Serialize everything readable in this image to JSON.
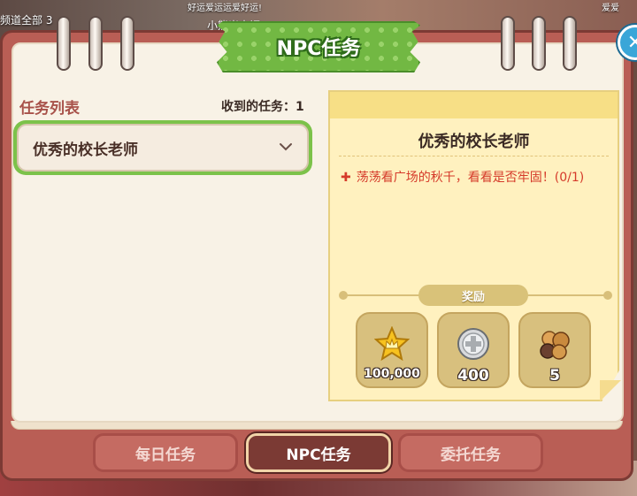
{
  "background": {
    "top_texts": [
      "频道全部 3",
      "小熊米大福",
      "好运爱运运爱好运!",
      "爱爱"
    ]
  },
  "dialog": {
    "title": "NPC任务",
    "close_icon": "close-icon"
  },
  "quest_list": {
    "heading": "任务列表",
    "received_label": "收到的任务：1",
    "items": [
      {
        "label": "优秀的校长老师",
        "selected": true
      }
    ]
  },
  "quest_detail": {
    "title": "优秀的校长老师",
    "objective": "荡荡看广场的秋千，看看是否牢固！(0/1)",
    "reward_label": "奖励",
    "rewards": [
      {
        "icon": "star-crown-icon",
        "value": "100,000"
      },
      {
        "icon": "silver-coin-icon",
        "value": "400"
      },
      {
        "icon": "cookie-pile-icon",
        "value": "5"
      }
    ]
  },
  "tabs": [
    {
      "label": "每日任务",
      "active": false
    },
    {
      "label": "NPC任务",
      "active": true
    },
    {
      "label": "委托任务",
      "active": false
    }
  ],
  "colors": {
    "accent_green": "#7cc24a",
    "book_red": "#b95e55",
    "objective_red": "#d53a2a",
    "note_yellow": "#fff1bf"
  }
}
